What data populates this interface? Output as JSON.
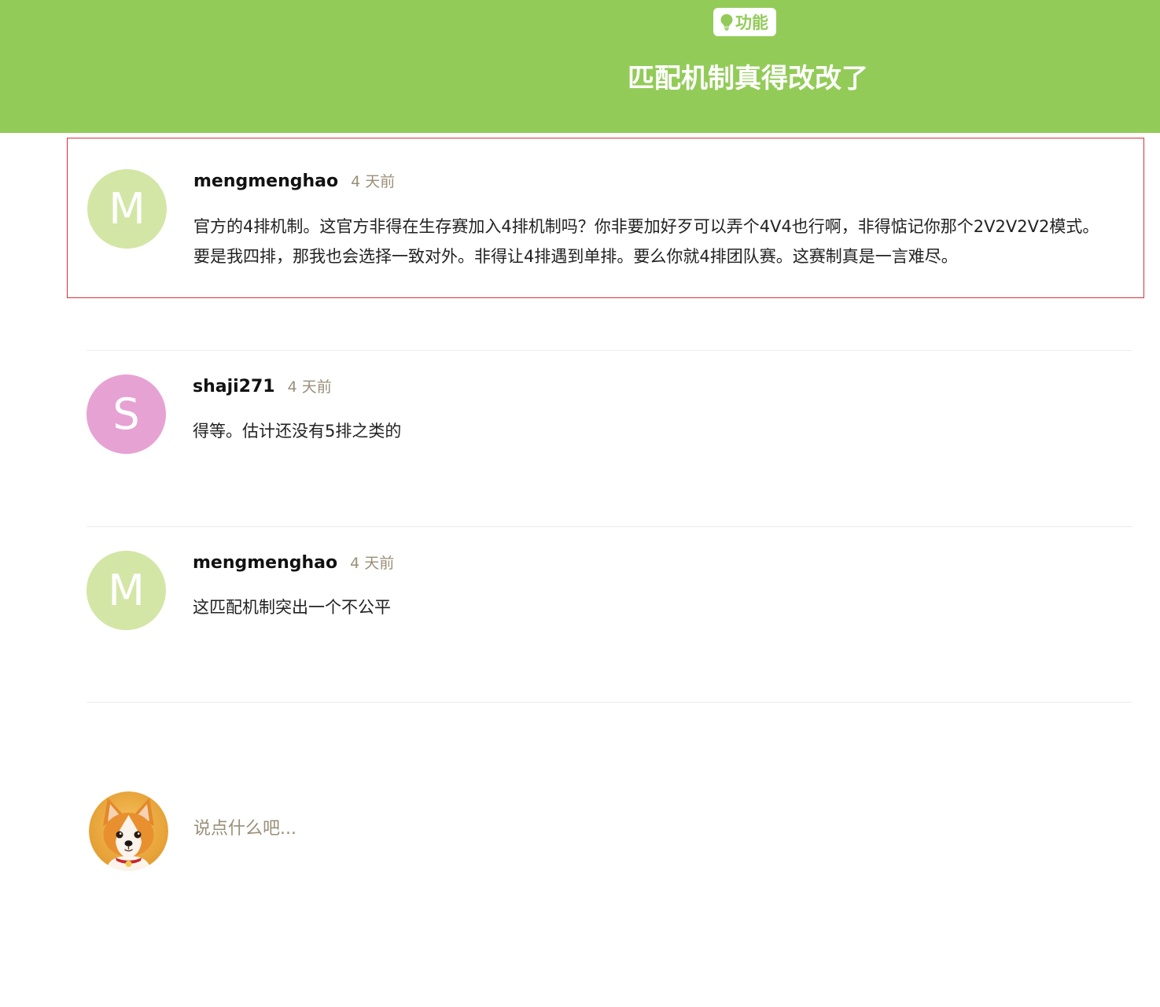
{
  "header": {
    "tag_label": "功能",
    "title": "匹配机制真得改改了",
    "bg_color": "#93cb59"
  },
  "comments": [
    {
      "avatar_letter": "M",
      "avatar_color": "#d3e6a6",
      "username": "mengmenghao",
      "time": "4 天前",
      "text": "官方的4排机制。这官方非得在生存赛加入4排机制吗？你非要加好歹可以弄个4V4也行啊，非得惦记你那个2V2V2V2模式。要是我四排，那我也会选择一致对外。非得让4排遇到单排。要么你就4排团队赛。这赛制真是一言难尽。"
    },
    {
      "avatar_letter": "S",
      "avatar_color": "#e6a2d3",
      "username": "shaji271",
      "time": "4 天前",
      "text": "得等。估计还没有5排之类的"
    },
    {
      "avatar_letter": "M",
      "avatar_color": "#d3e6a6",
      "username": "mengmenghao",
      "time": "4 天前",
      "text": "这匹配机制突出一个不公平"
    }
  ],
  "compose": {
    "placeholder": "说点什么吧...",
    "avatar_icon": "corgi-avatar-icon"
  }
}
